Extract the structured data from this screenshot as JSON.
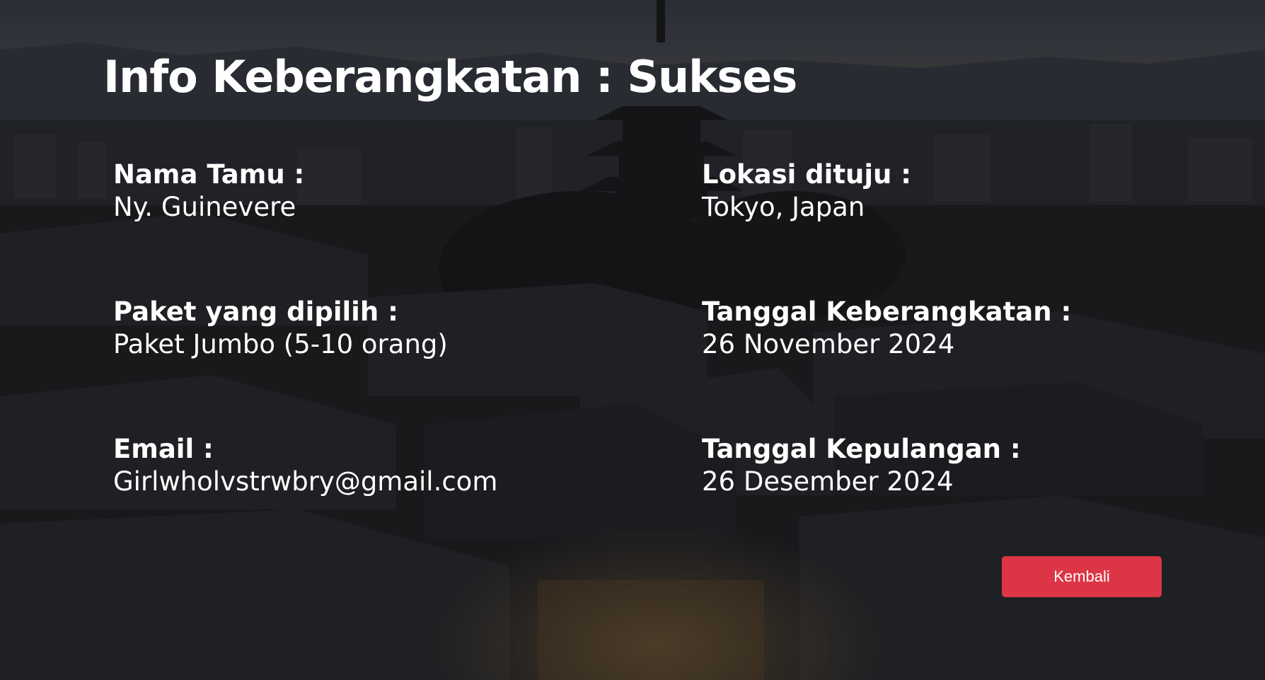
{
  "page": {
    "title": "Info Keberangkatan : Sukses"
  },
  "details": {
    "guest_name": {
      "label": "Nama Tamu :",
      "value": "Ny. Guinevere"
    },
    "destination": {
      "label": "Lokasi dituju :",
      "value": "Tokyo, Japan"
    },
    "package": {
      "label": "Paket yang dipilih :",
      "value": "Paket Jumbo (5-10 orang)"
    },
    "departure_date": {
      "label": "Tanggal Keberangkatan :",
      "value": "26 November 2024"
    },
    "email": {
      "label": "Email :",
      "value": "Girlwholvstrwbry@gmail.com"
    },
    "return_date": {
      "label": "Tanggal Kepulangan :",
      "value": "26 Desember 2024"
    }
  },
  "actions": {
    "back_label": "Kembali"
  },
  "colors": {
    "accent_button": "#dc3545",
    "text": "#ffffff",
    "background": "#232528"
  }
}
